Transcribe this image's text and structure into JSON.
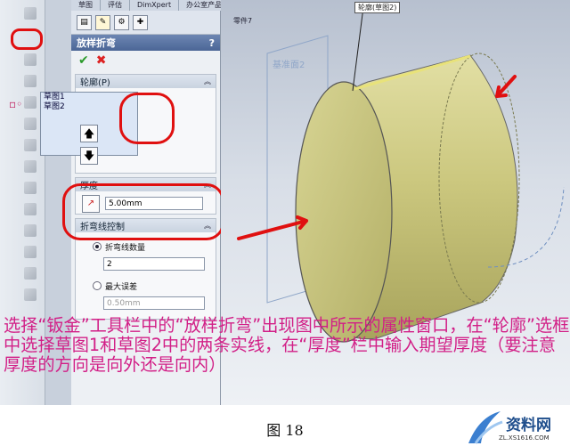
{
  "tabs": [
    "草图",
    "评估",
    "DimXpert",
    "办公室产品"
  ],
  "panel": {
    "title": "放样折弯",
    "help": "?",
    "profile": {
      "label": "轮廓(P)",
      "items": [
        "草图1",
        "草图2"
      ]
    },
    "thickness": {
      "label": "厚度",
      "value": "5.00mm"
    },
    "bend_lines": {
      "label": "折弯线控制",
      "option_count": "折弯线数量",
      "count_value": "2",
      "option_deviation": "最大误差",
      "deviation_value": "0.50mm"
    }
  },
  "view": {
    "top_label": "轮廓(草图2)",
    "tree_item": "零件7",
    "plane_label": "基准面2"
  },
  "caption": "选择“钣金”工具栏中的“放样折弯”出现图中所示的属性窗口，在“轮廓”选框中选择草图1和草图2中的两条实线，在“厚度”栏中输入期望厚度（要注意厚度的方向是向外还是向内）",
  "figure": "图 18",
  "colors": {
    "annotation": "#e01010",
    "caption": "#d21f87",
    "cylinder": "#c9c67a",
    "panel_header": "#4b6696"
  }
}
